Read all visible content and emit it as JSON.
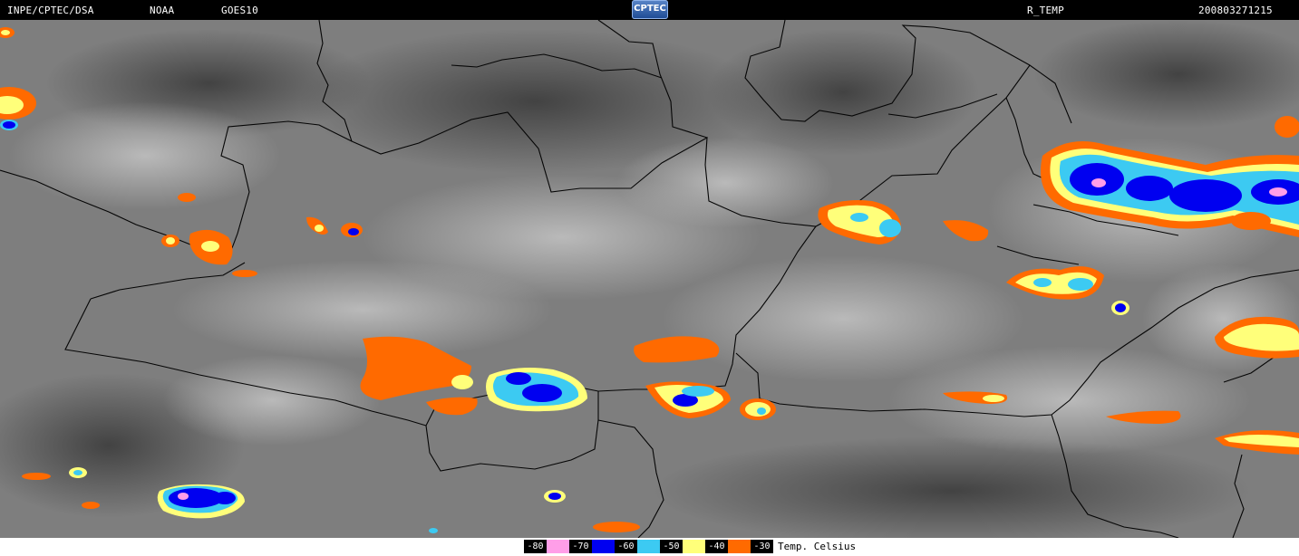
{
  "header": {
    "source": "INPE/CPTEC/DSA",
    "agency": "NOAA",
    "satellite": "GOES10",
    "logo_text": "CPTEC",
    "product": "R_TEMP",
    "timestamp": "200803271215"
  },
  "legend": {
    "unit": "Temp. Celsius",
    "items": [
      {
        "label": "-80",
        "color": "#ff9ee8"
      },
      {
        "label": "-70",
        "color": "#0000f0"
      },
      {
        "label": "-60",
        "color": "#3ccaf2"
      },
      {
        "label": "-50",
        "color": "#ffff7a"
      },
      {
        "label": "-40",
        "color": "#ff6a00"
      },
      {
        "label": "-30",
        "color": null
      }
    ]
  },
  "colors": {
    "background": "#000000",
    "borders": "#050505",
    "cloud_gray": "#8a8a8a"
  }
}
